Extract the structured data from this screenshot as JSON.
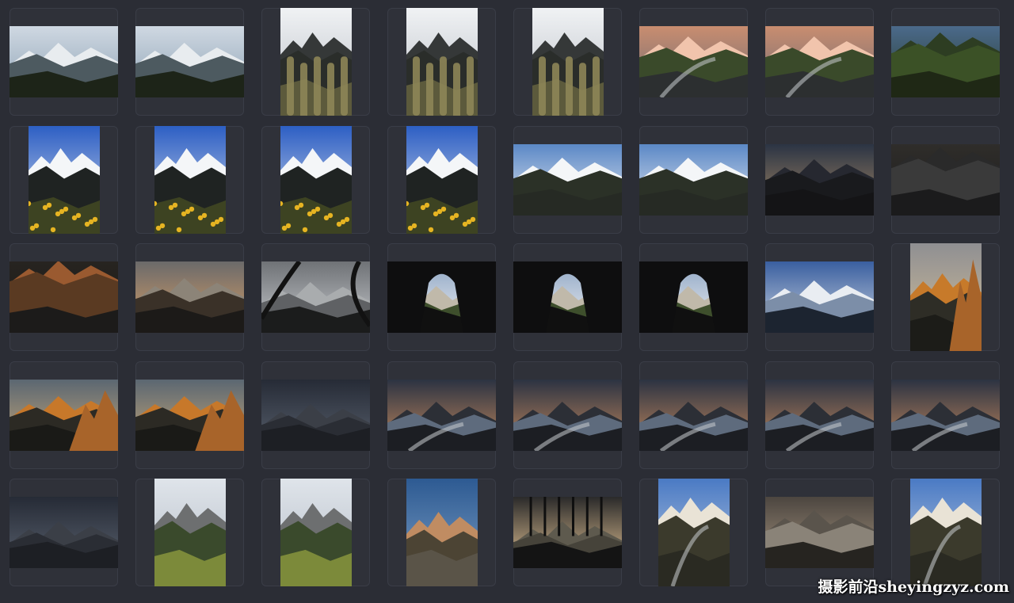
{
  "grid": {
    "rows": 5,
    "columns": 8,
    "thumbnails": [
      [
        "landscape",
        "forest-valley"
      ],
      [
        "landscape",
        "forest-valley"
      ],
      [
        "portrait",
        "cactus-peaks"
      ],
      [
        "portrait",
        "cactus-peaks"
      ],
      [
        "portrait",
        "cactus-peaks"
      ],
      [
        "landscape",
        "river-sunrise"
      ],
      [
        "landscape",
        "river-sunrise"
      ],
      [
        "landscape",
        "green-valley"
      ],
      [
        "portrait",
        "flower-peaks"
      ],
      [
        "portrait",
        "flower-peaks"
      ],
      [
        "portrait",
        "flower-peaks"
      ],
      [
        "portrait",
        "flower-peaks"
      ],
      [
        "landscape",
        "lupine-mountains"
      ],
      [
        "landscape",
        "lupine-mountains"
      ],
      [
        "landscape",
        "dark-peak-dawn"
      ],
      [
        "landscape",
        "dark-rocks"
      ],
      [
        "landscape",
        "dark-rocks-glow"
      ],
      [
        "landscape",
        "volcano-dusk"
      ],
      [
        "landscape",
        "tree-frame"
      ],
      [
        "landscape",
        "cave-frame"
      ],
      [
        "landscape",
        "cave-frame"
      ],
      [
        "landscape",
        "cave-frame"
      ],
      [
        "landscape",
        "misty-range"
      ],
      [
        "portrait",
        "golden-spire"
      ],
      [
        "landscape",
        "golden-spire-wide"
      ],
      [
        "landscape",
        "golden-spire-wide"
      ],
      [
        "landscape",
        "storm-ridge"
      ],
      [
        "landscape",
        "lake-sunset"
      ],
      [
        "landscape",
        "lake-sunset"
      ],
      [
        "landscape",
        "lake-sunset"
      ],
      [
        "landscape",
        "lake-sunset"
      ],
      [
        "landscape",
        "lake-sunset"
      ],
      [
        "landscape",
        "storm-ridge"
      ],
      [
        "portrait",
        "dolomites-meadow"
      ],
      [
        "portrait",
        "dolomites-meadow"
      ],
      [
        "portrait",
        "dolomite-tree"
      ],
      [
        "landscape",
        "palm-silhouette"
      ],
      [
        "portrait",
        "fitzroy-river"
      ],
      [
        "landscape",
        "fog-sea"
      ],
      [
        "portrait",
        "fitzroy-river"
      ]
    ]
  },
  "watermark": {
    "text": "摄影前沿sheyingzyz.com"
  }
}
